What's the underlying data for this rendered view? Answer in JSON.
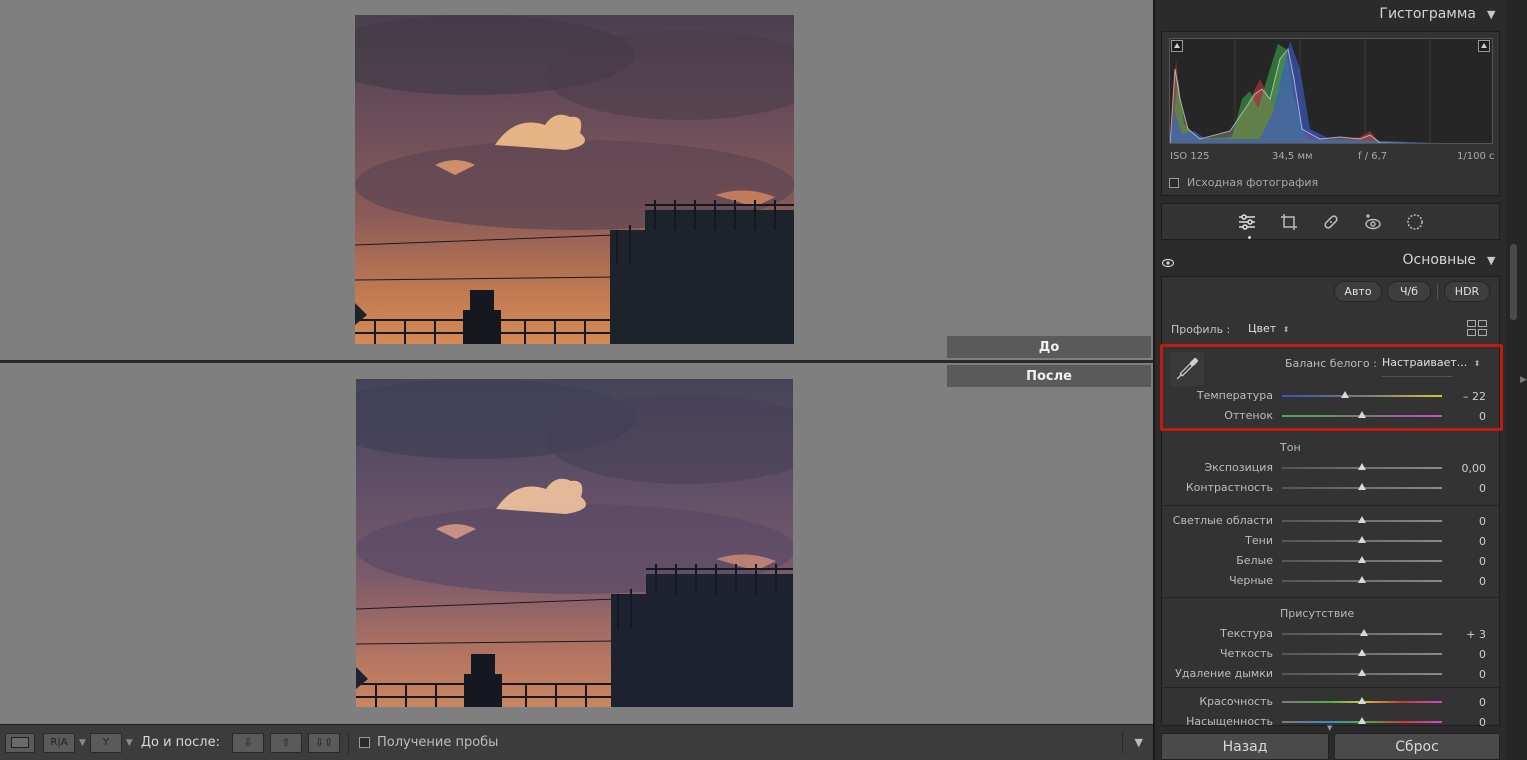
{
  "histogram": {
    "title": "Гистограмма",
    "iso": "ISO 125",
    "focal": "34,5 мм",
    "aperture": "f / 6,7",
    "shutter": "1/100 с",
    "original_photo_label": "Исходная фотография"
  },
  "labels": {
    "before": "До",
    "after": "После"
  },
  "basic": {
    "title": "Основные",
    "auto": "Авто",
    "bw": "Ч/б",
    "hdr": "HDR",
    "profile_label": "Профиль :",
    "profile_value": "Цвет",
    "wb_label": "Баланс белого :",
    "wb_value": "Настраивает...",
    "temperature_label": "Температура",
    "temperature_value": "– 22",
    "temperature_level": 0.4,
    "tint_label": "Оттенок",
    "tint_value": "0",
    "tone_head": "Тон",
    "exposure_label": "Экспозиция",
    "exposure_value": "0,00",
    "contrast_label": "Контрастность",
    "contrast_value": "0",
    "highlights_label": "Светлые области",
    "highlights_value": "0",
    "shadows_label": "Тени",
    "shadows_value": "0",
    "whites_label": "Белые",
    "whites_value": "0",
    "blacks_label": "Черные",
    "blacks_value": "0",
    "presence_head": "Присутствие",
    "texture_label": "Текстура",
    "texture_value": "+ 3",
    "clarity_label": "Четкость",
    "clarity_value": "0",
    "dehaze_label": "Удаление дымки",
    "dehaze_value": "0",
    "vibrance_label": "Красочность",
    "vibrance_value": "0",
    "saturation_label": "Насыщенность",
    "saturation_value": "0"
  },
  "toolbar": {
    "before_after_label": "До и после:",
    "soft_proof_label": "Получение пробы",
    "ra_label": "R|A",
    "y_label": "Y"
  },
  "footer": {
    "back": "Назад",
    "reset": "Сброс"
  },
  "colors": {
    "highlight": "#c01c12",
    "panel_bg": "#2b2b2b",
    "canvas_bg": "#808080"
  }
}
